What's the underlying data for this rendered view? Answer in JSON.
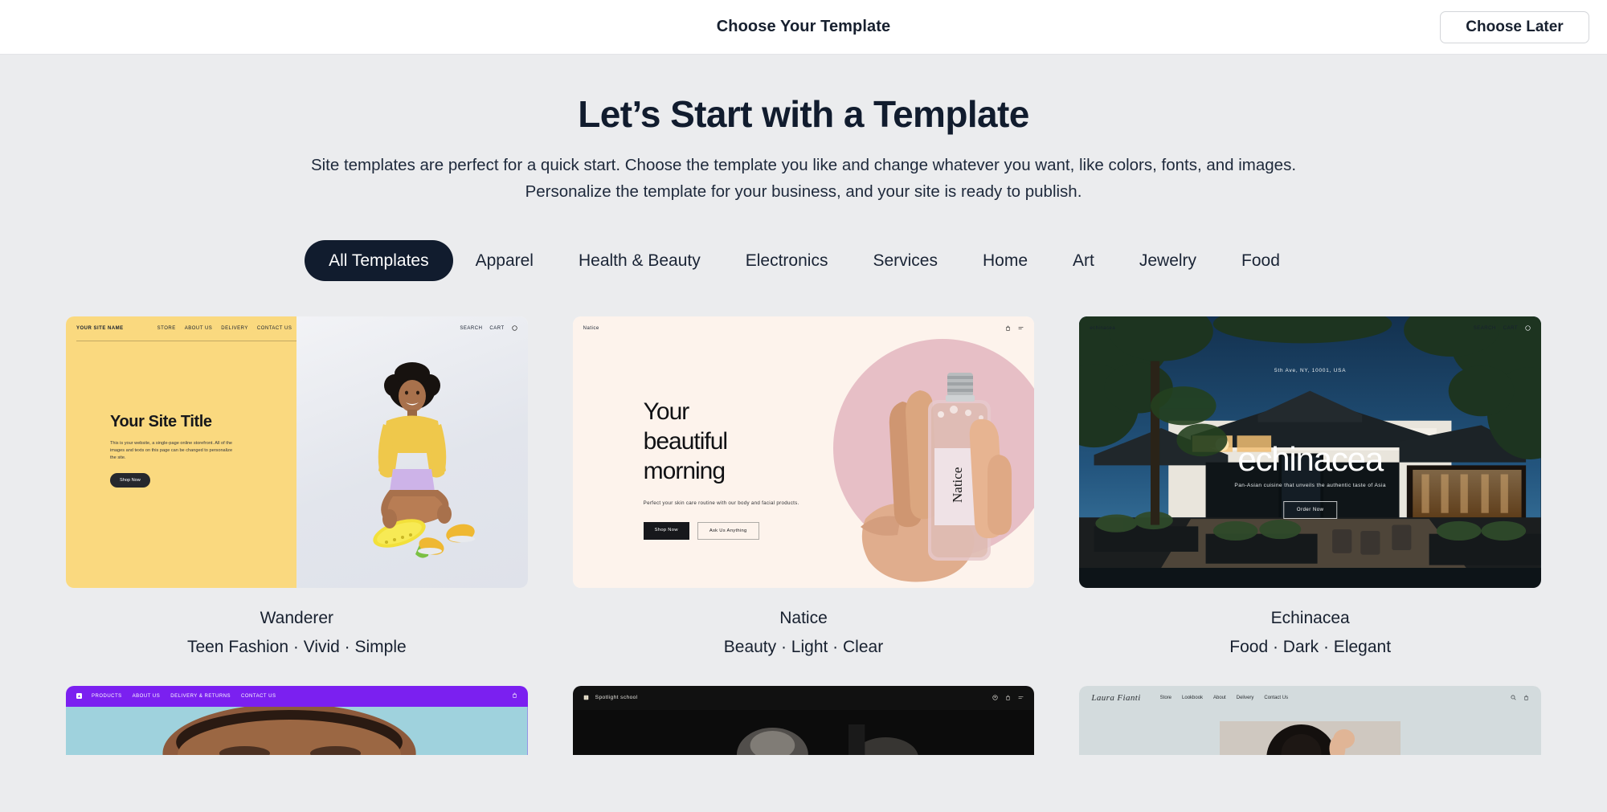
{
  "topbar": {
    "title": "Choose Your Template",
    "choose_later_label": "Choose Later"
  },
  "hero": {
    "heading": "Let’s Start with a Template",
    "paragraph": "Site templates are perfect for a quick start. Choose the template you like and change whatever you want, like colors, fonts, and images. Personalize the template for your business, and your site is ready to publish."
  },
  "tabs": [
    {
      "label": "All Templates",
      "active": true
    },
    {
      "label": "Apparel",
      "active": false
    },
    {
      "label": "Health & Beauty",
      "active": false
    },
    {
      "label": "Electronics",
      "active": false
    },
    {
      "label": "Services",
      "active": false
    },
    {
      "label": "Home",
      "active": false
    },
    {
      "label": "Art",
      "active": false
    },
    {
      "label": "Jewelry",
      "active": false
    },
    {
      "label": "Food",
      "active": false
    }
  ],
  "colors": {
    "page_background": "#ebecee",
    "topbar_background": "#ffffff",
    "accent_dark": "#111c2e",
    "text": "#17202f",
    "wanderer_yellow": "#fad97f",
    "natice_cream": "#fdf3ec",
    "natice_pink": "#e7bfc6",
    "purple": "#7b20f0",
    "spotlight_black": "#111111",
    "laura_grey": "#d3dbdd"
  },
  "templates": [
    {
      "id": "wanderer",
      "title": "Wanderer",
      "subtitle": "Teen Fashion · Vivid · Simple",
      "site": {
        "logo": "YOUR SITE NAME",
        "links": [
          "STORE",
          "ABOUT US",
          "DELIVERY",
          "CONTACT US"
        ],
        "right_links": [
          "SEARCH",
          "CART"
        ],
        "headline": "Your Site Title",
        "body": "This is your website, a single-page online storefront. All of the images and texts on this page can be changed to personalize the site.",
        "button": "Shop Now"
      }
    },
    {
      "id": "natice",
      "title": "Natice",
      "subtitle": "Beauty · Light · Clear",
      "site": {
        "logo": "Natice",
        "headline_lines": [
          "Your",
          "beautiful",
          "morning"
        ],
        "body": "Perfect your skin care routine with our body and facial products.",
        "button_primary": "Shop Now",
        "button_secondary": "Ask Us Anything",
        "bottle_label": "Natice"
      }
    },
    {
      "id": "echinacea",
      "title": "Echinacea",
      "subtitle": "Food · Dark · Elegant",
      "site": {
        "logo": "echinacea",
        "right_links": [
          "SEARCH",
          "CART"
        ],
        "address": "5th Ave, NY, 10001, USA",
        "wordmark": "echinacea",
        "tagline": "Pan-Asian cuisine that unveils the authentic taste of Asia",
        "button": "Order Now"
      }
    }
  ],
  "templates_row2": [
    {
      "id": "purple-apparel",
      "site": {
        "links": [
          "PRODUCTS",
          "ABOUT US",
          "DELIVERY & RETURNS",
          "CONTACT US"
        ]
      }
    },
    {
      "id": "spotlight-school",
      "site": {
        "logo": "Spotlight school"
      }
    },
    {
      "id": "laura-fianti",
      "site": {
        "logo": "Laura Fianti",
        "links": [
          "Store",
          "Lookbook",
          "About",
          "Delivery",
          "Contact Us"
        ]
      }
    }
  ]
}
